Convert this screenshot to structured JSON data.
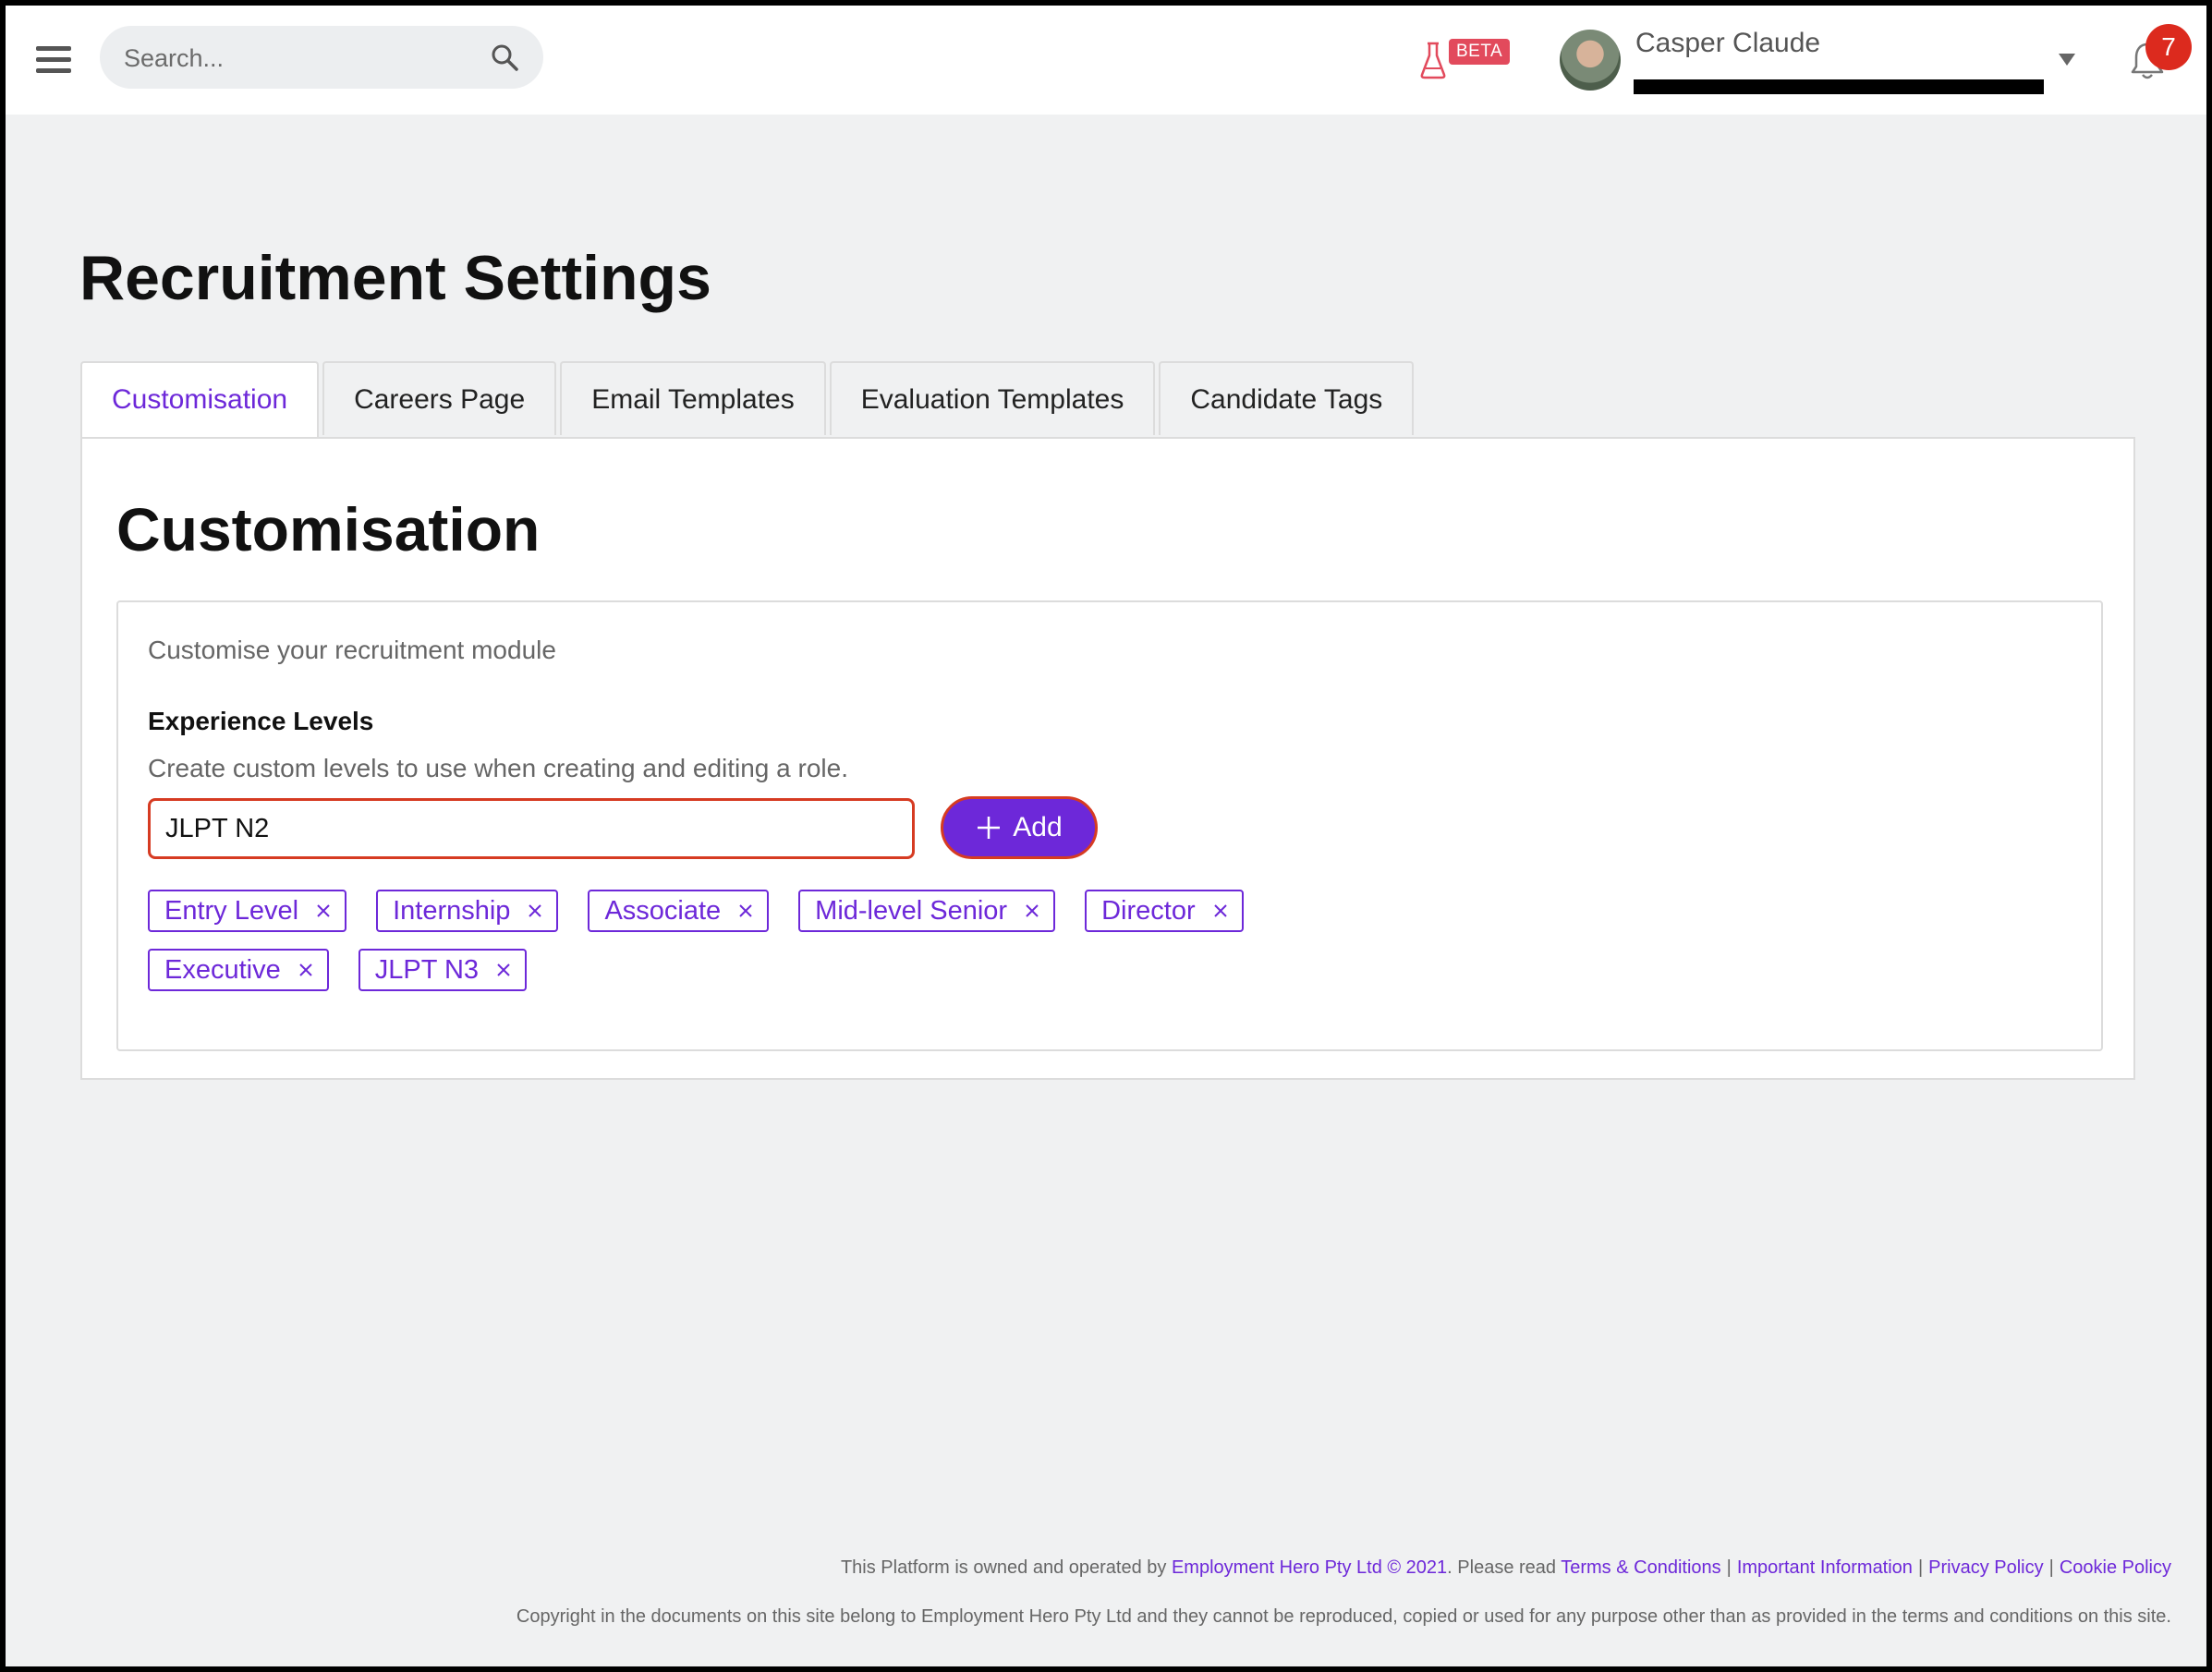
{
  "header": {
    "search_placeholder": "Search...",
    "beta_label": "BETA",
    "user_name": "Casper Claude",
    "notification_count": "7"
  },
  "page": {
    "title": "Recruitment Settings"
  },
  "tabs": [
    {
      "label": "Customisation",
      "active": true
    },
    {
      "label": "Careers Page",
      "active": false
    },
    {
      "label": "Email Templates",
      "active": false
    },
    {
      "label": "Evaluation Templates",
      "active": false
    },
    {
      "label": "Candidate Tags",
      "active": false
    }
  ],
  "customisation": {
    "title": "Customisation",
    "description": "Customise your recruitment module",
    "experience_levels": {
      "label": "Experience Levels",
      "help": "Create custom levels to use when creating and editing a role.",
      "input_value": "JLPT N2",
      "add_label": "Add",
      "tags": [
        "Entry Level",
        "Internship",
        "Associate",
        "Mid-level Senior",
        "Director",
        "Executive",
        "JLPT N3"
      ]
    }
  },
  "footer": {
    "owned_prefix": "This Platform is owned and operated by",
    "company_link": "Employment Hero Pty Ltd © 2021",
    "please_read": ". Please read",
    "terms": "Terms & Conditions",
    "important": "Important Information",
    "privacy": "Privacy Policy",
    "cookie": "Cookie Policy",
    "copyright": "Copyright in the documents on this site belong to Employment Hero Pty Ltd and they cannot be reproduced, copied or used for any purpose other than as provided in the terms and conditions on this site."
  },
  "colors": {
    "accent": "#6d28d9",
    "error_border": "#d63b22",
    "badge": "#dc2a1e",
    "page_bg": "#f0f1f2"
  }
}
